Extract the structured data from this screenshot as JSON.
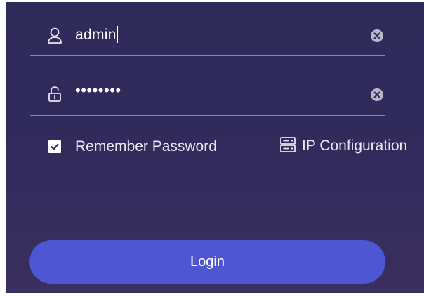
{
  "username_field": {
    "value": "admin",
    "icon": "user-icon"
  },
  "password_field": {
    "value": "••••••••",
    "icon": "lock-icon"
  },
  "clear_icon": "clear-circle-icon",
  "remember_password": {
    "label": "Remember Password",
    "checked": true
  },
  "ip_configuration": {
    "label": "IP Configuration",
    "icon": "server-icon"
  },
  "login_button": {
    "label": "Login"
  },
  "colors": {
    "background": "#312b5b",
    "accent": "#4f56d3",
    "text": "#ffffff",
    "divider": "#8b89a6"
  }
}
